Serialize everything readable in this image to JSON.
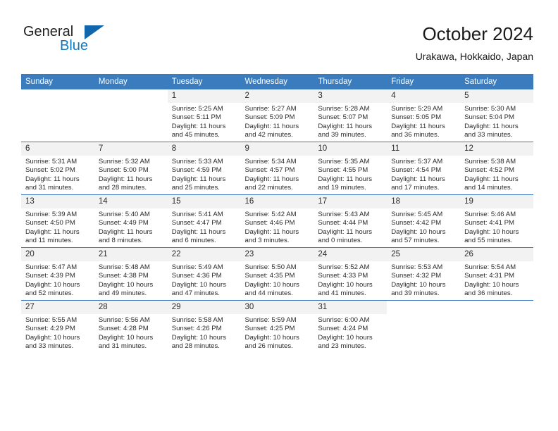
{
  "brand": {
    "name_part1": "General",
    "name_part2": "Blue",
    "triangle_color": "#1267ac",
    "blue_color": "#1278be"
  },
  "header": {
    "month_title": "October 2024",
    "location": "Urakawa, Hokkaido, Japan",
    "header_bg_color": "#3a7cbe",
    "daynum_bg_color": "#f2f2f2"
  },
  "calendar": {
    "weekday_headers": [
      "Sunday",
      "Monday",
      "Tuesday",
      "Wednesday",
      "Thursday",
      "Friday",
      "Saturday"
    ],
    "weeks": [
      [
        {
          "day": "",
          "blank": true,
          "sunrise": "",
          "sunset": "",
          "daylight_l1": "",
          "daylight_l2": ""
        },
        {
          "day": "",
          "blank": true,
          "sunrise": "",
          "sunset": "",
          "daylight_l1": "",
          "daylight_l2": ""
        },
        {
          "day": "1",
          "sunrise": "Sunrise: 5:25 AM",
          "sunset": "Sunset: 5:11 PM",
          "daylight_l1": "Daylight: 11 hours",
          "daylight_l2": "and 45 minutes."
        },
        {
          "day": "2",
          "sunrise": "Sunrise: 5:27 AM",
          "sunset": "Sunset: 5:09 PM",
          "daylight_l1": "Daylight: 11 hours",
          "daylight_l2": "and 42 minutes."
        },
        {
          "day": "3",
          "sunrise": "Sunrise: 5:28 AM",
          "sunset": "Sunset: 5:07 PM",
          "daylight_l1": "Daylight: 11 hours",
          "daylight_l2": "and 39 minutes."
        },
        {
          "day": "4",
          "sunrise": "Sunrise: 5:29 AM",
          "sunset": "Sunset: 5:05 PM",
          "daylight_l1": "Daylight: 11 hours",
          "daylight_l2": "and 36 minutes."
        },
        {
          "day": "5",
          "sunrise": "Sunrise: 5:30 AM",
          "sunset": "Sunset: 5:04 PM",
          "daylight_l1": "Daylight: 11 hours",
          "daylight_l2": "and 33 minutes."
        }
      ],
      [
        {
          "day": "6",
          "sunrise": "Sunrise: 5:31 AM",
          "sunset": "Sunset: 5:02 PM",
          "daylight_l1": "Daylight: 11 hours",
          "daylight_l2": "and 31 minutes."
        },
        {
          "day": "7",
          "sunrise": "Sunrise: 5:32 AM",
          "sunset": "Sunset: 5:00 PM",
          "daylight_l1": "Daylight: 11 hours",
          "daylight_l2": "and 28 minutes."
        },
        {
          "day": "8",
          "sunrise": "Sunrise: 5:33 AM",
          "sunset": "Sunset: 4:59 PM",
          "daylight_l1": "Daylight: 11 hours",
          "daylight_l2": "and 25 minutes."
        },
        {
          "day": "9",
          "sunrise": "Sunrise: 5:34 AM",
          "sunset": "Sunset: 4:57 PM",
          "daylight_l1": "Daylight: 11 hours",
          "daylight_l2": "and 22 minutes."
        },
        {
          "day": "10",
          "sunrise": "Sunrise: 5:35 AM",
          "sunset": "Sunset: 4:55 PM",
          "daylight_l1": "Daylight: 11 hours",
          "daylight_l2": "and 19 minutes."
        },
        {
          "day": "11",
          "sunrise": "Sunrise: 5:37 AM",
          "sunset": "Sunset: 4:54 PM",
          "daylight_l1": "Daylight: 11 hours",
          "daylight_l2": "and 17 minutes."
        },
        {
          "day": "12",
          "sunrise": "Sunrise: 5:38 AM",
          "sunset": "Sunset: 4:52 PM",
          "daylight_l1": "Daylight: 11 hours",
          "daylight_l2": "and 14 minutes."
        }
      ],
      [
        {
          "day": "13",
          "sunrise": "Sunrise: 5:39 AM",
          "sunset": "Sunset: 4:50 PM",
          "daylight_l1": "Daylight: 11 hours",
          "daylight_l2": "and 11 minutes."
        },
        {
          "day": "14",
          "sunrise": "Sunrise: 5:40 AM",
          "sunset": "Sunset: 4:49 PM",
          "daylight_l1": "Daylight: 11 hours",
          "daylight_l2": "and 8 minutes."
        },
        {
          "day": "15",
          "sunrise": "Sunrise: 5:41 AM",
          "sunset": "Sunset: 4:47 PM",
          "daylight_l1": "Daylight: 11 hours",
          "daylight_l2": "and 6 minutes."
        },
        {
          "day": "16",
          "sunrise": "Sunrise: 5:42 AM",
          "sunset": "Sunset: 4:46 PM",
          "daylight_l1": "Daylight: 11 hours",
          "daylight_l2": "and 3 minutes."
        },
        {
          "day": "17",
          "sunrise": "Sunrise: 5:43 AM",
          "sunset": "Sunset: 4:44 PM",
          "daylight_l1": "Daylight: 11 hours",
          "daylight_l2": "and 0 minutes."
        },
        {
          "day": "18",
          "sunrise": "Sunrise: 5:45 AM",
          "sunset": "Sunset: 4:42 PM",
          "daylight_l1": "Daylight: 10 hours",
          "daylight_l2": "and 57 minutes."
        },
        {
          "day": "19",
          "sunrise": "Sunrise: 5:46 AM",
          "sunset": "Sunset: 4:41 PM",
          "daylight_l1": "Daylight: 10 hours",
          "daylight_l2": "and 55 minutes."
        }
      ],
      [
        {
          "day": "20",
          "sunrise": "Sunrise: 5:47 AM",
          "sunset": "Sunset: 4:39 PM",
          "daylight_l1": "Daylight: 10 hours",
          "daylight_l2": "and 52 minutes."
        },
        {
          "day": "21",
          "sunrise": "Sunrise: 5:48 AM",
          "sunset": "Sunset: 4:38 PM",
          "daylight_l1": "Daylight: 10 hours",
          "daylight_l2": "and 49 minutes."
        },
        {
          "day": "22",
          "sunrise": "Sunrise: 5:49 AM",
          "sunset": "Sunset: 4:36 PM",
          "daylight_l1": "Daylight: 10 hours",
          "daylight_l2": "and 47 minutes."
        },
        {
          "day": "23",
          "sunrise": "Sunrise: 5:50 AM",
          "sunset": "Sunset: 4:35 PM",
          "daylight_l1": "Daylight: 10 hours",
          "daylight_l2": "and 44 minutes."
        },
        {
          "day": "24",
          "sunrise": "Sunrise: 5:52 AM",
          "sunset": "Sunset: 4:33 PM",
          "daylight_l1": "Daylight: 10 hours",
          "daylight_l2": "and 41 minutes."
        },
        {
          "day": "25",
          "sunrise": "Sunrise: 5:53 AM",
          "sunset": "Sunset: 4:32 PM",
          "daylight_l1": "Daylight: 10 hours",
          "daylight_l2": "and 39 minutes."
        },
        {
          "day": "26",
          "sunrise": "Sunrise: 5:54 AM",
          "sunset": "Sunset: 4:31 PM",
          "daylight_l1": "Daylight: 10 hours",
          "daylight_l2": "and 36 minutes."
        }
      ],
      [
        {
          "day": "27",
          "sunrise": "Sunrise: 5:55 AM",
          "sunset": "Sunset: 4:29 PM",
          "daylight_l1": "Daylight: 10 hours",
          "daylight_l2": "and 33 minutes."
        },
        {
          "day": "28",
          "sunrise": "Sunrise: 5:56 AM",
          "sunset": "Sunset: 4:28 PM",
          "daylight_l1": "Daylight: 10 hours",
          "daylight_l2": "and 31 minutes."
        },
        {
          "day": "29",
          "sunrise": "Sunrise: 5:58 AM",
          "sunset": "Sunset: 4:26 PM",
          "daylight_l1": "Daylight: 10 hours",
          "daylight_l2": "and 28 minutes."
        },
        {
          "day": "30",
          "sunrise": "Sunrise: 5:59 AM",
          "sunset": "Sunset: 4:25 PM",
          "daylight_l1": "Daylight: 10 hours",
          "daylight_l2": "and 26 minutes."
        },
        {
          "day": "31",
          "sunrise": "Sunrise: 6:00 AM",
          "sunset": "Sunset: 4:24 PM",
          "daylight_l1": "Daylight: 10 hours",
          "daylight_l2": "and 23 minutes."
        },
        {
          "day": "",
          "blank": true,
          "sunrise": "",
          "sunset": "",
          "daylight_l1": "",
          "daylight_l2": ""
        },
        {
          "day": "",
          "blank": true,
          "sunrise": "",
          "sunset": "",
          "daylight_l1": "",
          "daylight_l2": ""
        }
      ]
    ]
  }
}
